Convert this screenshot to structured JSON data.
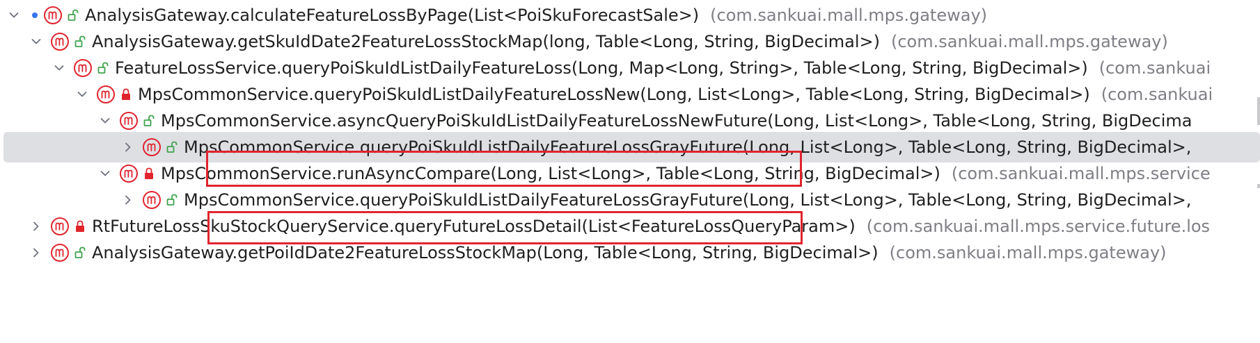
{
  "tree": {
    "rows": [
      {
        "method": "AnalysisGateway.calculateFeatureLossByPage(List<PoiSkuForecastSale>)",
        "package": "(com.sankuai.mall.mps.gateway)",
        "expanded": true,
        "access": "public"
      },
      {
        "method": "AnalysisGateway.getSkuIdDate2FeatureLossStockMap(long, Table<Long, String, BigDecimal>)",
        "package": "(com.sankuai.mall.mps.gateway)",
        "expanded": true,
        "access": "public"
      },
      {
        "method": "FeatureLossService.queryPoiSkuIdListDailyFeatureLoss(Long, Map<Long, String>, Table<Long, String, BigDecimal>)",
        "package": "(com.sankuai",
        "expanded": true,
        "access": "public"
      },
      {
        "method": "MpsCommonService.queryPoiSkuIdListDailyFeatureLossNew(Long, List<Long>, Table<Long, String, BigDecimal>)",
        "package": "(com.sankuai",
        "expanded": true,
        "access": "private"
      },
      {
        "method": "MpsCommonService.asyncQueryPoiSkuIdListDailyFeatureLossNewFuture(Long, List<Long>, Table<Long, String, BigDecima",
        "package": "",
        "expanded": true,
        "access": "public"
      },
      {
        "method": "MpsCommonService.queryPoiSkuIdListDailyFeatureLossGrayFuture(Long, List<Long>, Table<Long, String, BigDecimal>,",
        "package": "",
        "expanded": false,
        "access": "public"
      },
      {
        "method": "MpsCommonService.runAsyncCompare(Long, List<Long>, Table<Long, String, BigDecimal>)",
        "package": "(com.sankuai.mall.mps.service",
        "expanded": true,
        "access": "private"
      },
      {
        "method": "MpsCommonService.queryPoiSkuIdListDailyFeatureLossGrayFuture(Long, List<Long>, Table<Long, String, BigDecimal>,",
        "package": "",
        "expanded": false,
        "access": "public"
      },
      {
        "method": "RtFutureLossSkuStockQueryService.queryFutureLossDetail(List<FeatureLossQueryParam>)",
        "package": "(com.sankuai.mall.mps.service.future.los",
        "expanded": false,
        "access": "private"
      },
      {
        "method": "AnalysisGateway.getPoiIdDate2FeatureLossStockMap(Long, Table<Long, String, BigDecimal>)",
        "package": "(com.sankuai.mall.mps.gateway)",
        "expanded": false,
        "access": "public"
      }
    ]
  },
  "colors": {
    "method_icon": "#e0242e",
    "public_access": "#3fa34d",
    "private_access": "#e0242e",
    "package_text": "#7e7e85",
    "selection": "#dedfe3",
    "highlight": "#e0242e"
  },
  "icons": {
    "method": "method-m-icon",
    "public": "unlocked-padlock-icon",
    "private": "locked-padlock-icon",
    "expanded": "chevron-down-icon",
    "collapsed": "chevron-right-icon"
  }
}
